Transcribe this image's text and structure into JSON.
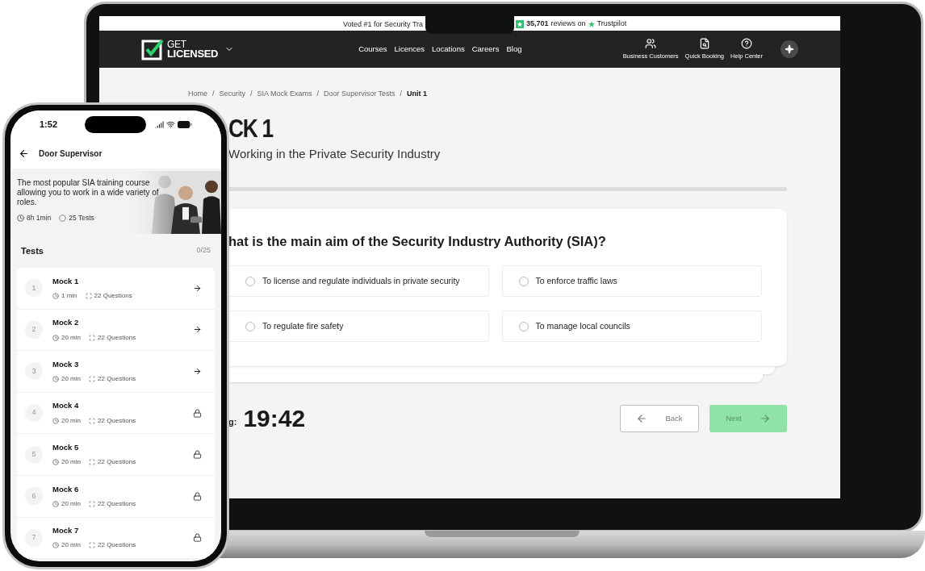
{
  "laptop": {
    "banner": {
      "left_text": "Voted #1 for Security Tra",
      "reviews_count": "35,701",
      "reviews_text": "reviews on",
      "trustpilot": "Trustpilot"
    },
    "nav": {
      "logo_top": "GET",
      "logo_bottom": "LICENSED",
      "links": [
        "Courses",
        "Licences",
        "Locations",
        "Careers",
        "Blog"
      ],
      "actions": [
        {
          "kind": "users",
          "label": "Business Customers"
        },
        {
          "kind": "booking",
          "label": "Quick Booking"
        },
        {
          "kind": "help",
          "label": "Help Center"
        }
      ]
    },
    "breadcrumb_separator": "/",
    "breadcrumb": [
      {
        "label": "Home",
        "selected": false
      },
      {
        "label": "Security",
        "selected": false
      },
      {
        "label": "SIA Mock Exams",
        "selected": false
      },
      {
        "label": "Door Supervisor Tests",
        "selected": false
      },
      {
        "label": "Unit 1",
        "selected": true
      }
    ],
    "title": "CK 1",
    "subtitle": "Working in the Private Security Industry",
    "question": "hat is the main aim of the Security Industry Authority (SIA)?",
    "options": [
      {
        "label": "To license and regulate individuals in private security",
        "selected": false
      },
      {
        "label": "To enforce traffic laws",
        "selected": false
      },
      {
        "label": "To regulate fire safety",
        "selected": false
      },
      {
        "label": "To manage local councils",
        "selected": false
      }
    ],
    "timer_label": "g:",
    "timer": "19:42",
    "back": "Back",
    "next": {
      "label": "Next",
      "disabled": true
    }
  },
  "phone": {
    "time": "1:52",
    "header": "Door Supervisor",
    "hero": {
      "text": "The most popular SIA training course allowing you to work in a wide variety of roles.",
      "duration": "8h 1min",
      "tests": "25 Tests"
    },
    "tests_title": "Tests",
    "tests_progress": "0/25",
    "tests": [
      {
        "number": "1",
        "name": "Mock 1",
        "duration": "1 min",
        "questions": "22 Questions",
        "kind": "open"
      },
      {
        "number": "2",
        "name": "Mock 2",
        "duration": "20 min",
        "questions": "22 Questions",
        "kind": "open"
      },
      {
        "number": "3",
        "name": "Mock 3",
        "duration": "20 min",
        "questions": "22 Questions",
        "kind": "open"
      },
      {
        "number": "4",
        "name": "Mock 4",
        "duration": "20 min",
        "questions": "22 Questions",
        "kind": "locked"
      },
      {
        "number": "5",
        "name": "Mock 5",
        "duration": "20 min",
        "questions": "22 Questions",
        "kind": "locked"
      },
      {
        "number": "6",
        "name": "Mock 6",
        "duration": "20 min",
        "questions": "22 Questions",
        "kind": "locked"
      },
      {
        "number": "7",
        "name": "Mock 7",
        "duration": "20 min",
        "questions": "22 Questions",
        "kind": "locked"
      }
    ]
  }
}
